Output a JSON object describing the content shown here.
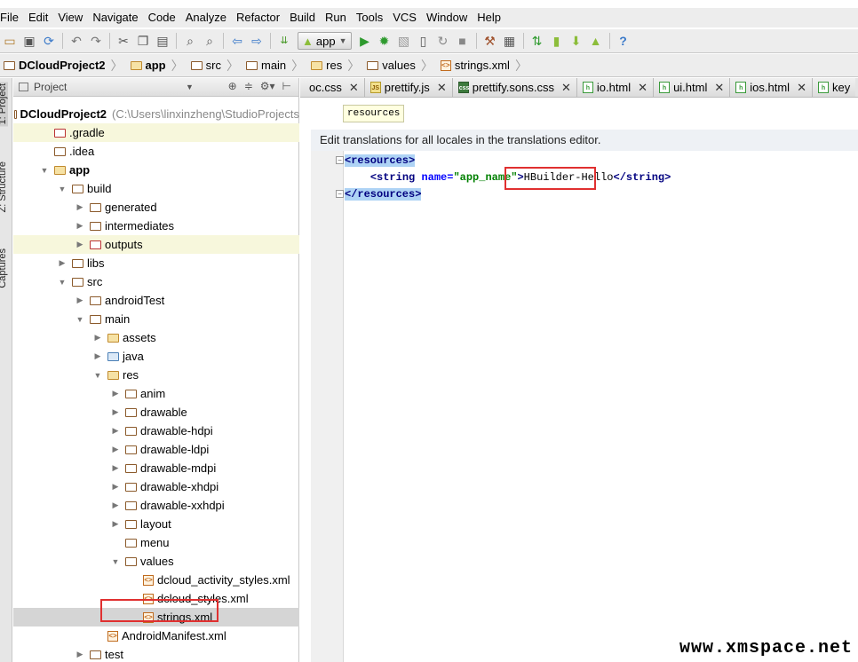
{
  "menubar": {
    "items": [
      "File",
      "Edit",
      "View",
      "Navigate",
      "Code",
      "Analyze",
      "Refactor",
      "Build",
      "Run",
      "Tools",
      "VCS",
      "Window",
      "Help"
    ]
  },
  "toolbar": {
    "run_config": "app"
  },
  "breadcrumb": {
    "items": [
      "DCloudProject2",
      "app",
      "src",
      "main",
      "res",
      "values",
      "strings.xml"
    ]
  },
  "side_tabs": {
    "project": "1: Project",
    "structure": "Z: Structure",
    "captures": "Captures"
  },
  "project_panel": {
    "view_mode": "Project",
    "tree": [
      {
        "label": "DCloudProject2",
        "path": "(C:\\Users\\linxinzheng\\StudioProjects",
        "indent": 0
      },
      {
        "label": ".gradle",
        "indent": 1
      },
      {
        "label": ".idea",
        "indent": 1
      },
      {
        "label": "app",
        "indent": 1
      },
      {
        "label": "build",
        "indent": 2
      },
      {
        "label": "generated",
        "indent": 3
      },
      {
        "label": "intermediates",
        "indent": 3
      },
      {
        "label": "outputs",
        "indent": 3
      },
      {
        "label": "libs",
        "indent": 2
      },
      {
        "label": "src",
        "indent": 2
      },
      {
        "label": "androidTest",
        "indent": 3
      },
      {
        "label": "main",
        "indent": 3
      },
      {
        "label": "assets",
        "indent": 4
      },
      {
        "label": "java",
        "indent": 4
      },
      {
        "label": "res",
        "indent": 4
      },
      {
        "label": "anim",
        "indent": 5
      },
      {
        "label": "drawable",
        "indent": 5
      },
      {
        "label": "drawable-hdpi",
        "indent": 5
      },
      {
        "label": "drawable-ldpi",
        "indent": 5
      },
      {
        "label": "drawable-mdpi",
        "indent": 5
      },
      {
        "label": "drawable-xhdpi",
        "indent": 5
      },
      {
        "label": "drawable-xxhdpi",
        "indent": 5
      },
      {
        "label": "layout",
        "indent": 5
      },
      {
        "label": "menu",
        "indent": 5
      },
      {
        "label": "values",
        "indent": 5
      },
      {
        "label": "dcloud_activity_styles.xml",
        "indent": 6
      },
      {
        "label": "dcloud_styles.xml",
        "indent": 6
      },
      {
        "label": "strings.xml",
        "indent": 6
      },
      {
        "label": "AndroidManifest.xml",
        "indent": 4
      },
      {
        "label": "test",
        "indent": 3
      }
    ]
  },
  "editor": {
    "tabs": [
      "oc.css",
      "prettify.js",
      "prettify.sons.css",
      "io.html",
      "ui.html",
      "ios.html",
      "key"
    ],
    "breadcrumb_tag": "resources",
    "notification": "Edit translations for all locales in the translations editor.",
    "code": {
      "open_tag": "<resources>",
      "line2_open": "<string",
      "line2_attr": "name=",
      "line2_value": "\"app_name\"",
      "line2_gt": ">",
      "line2_text": "HBuilder-Hello",
      "line2_close": "</string>",
      "close_tag": "</resources>"
    }
  },
  "watermark": "www.xmspace.net"
}
